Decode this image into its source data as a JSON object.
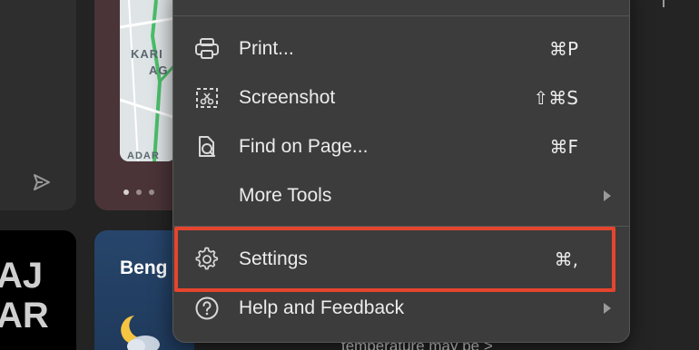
{
  "background": {
    "map_labels": [
      "KARI",
      "AG",
      "ADAR"
    ],
    "news_dark_text": [
      "AJ",
      "AR"
    ],
    "weather_title": "Beng",
    "weather_icon": "moon-cloud-icon",
    "send_icon": "send-icon",
    "bottom_text": "temperature may be >"
  },
  "menu": {
    "items": [
      {
        "label": "Print...",
        "shortcut": "⌘P",
        "icon": "print-icon"
      },
      {
        "label": "Screenshot",
        "shortcut": "⇧⌘S",
        "icon": "screenshot-icon"
      },
      {
        "label": "Find on Page...",
        "shortcut": "⌘F",
        "icon": "find-on-page-icon"
      },
      {
        "label": "More Tools",
        "shortcut": "",
        "icon": "",
        "has_submenu": true
      },
      {
        "label": "Settings",
        "shortcut": "⌘,",
        "icon": "gear-icon"
      },
      {
        "label": "Help and Feedback",
        "shortcut": "",
        "icon": "help-icon",
        "has_submenu": true
      }
    ]
  },
  "colors": {
    "menu_bg": "#3c3c3c",
    "highlight": "#e5452e",
    "text": "#ececec"
  }
}
